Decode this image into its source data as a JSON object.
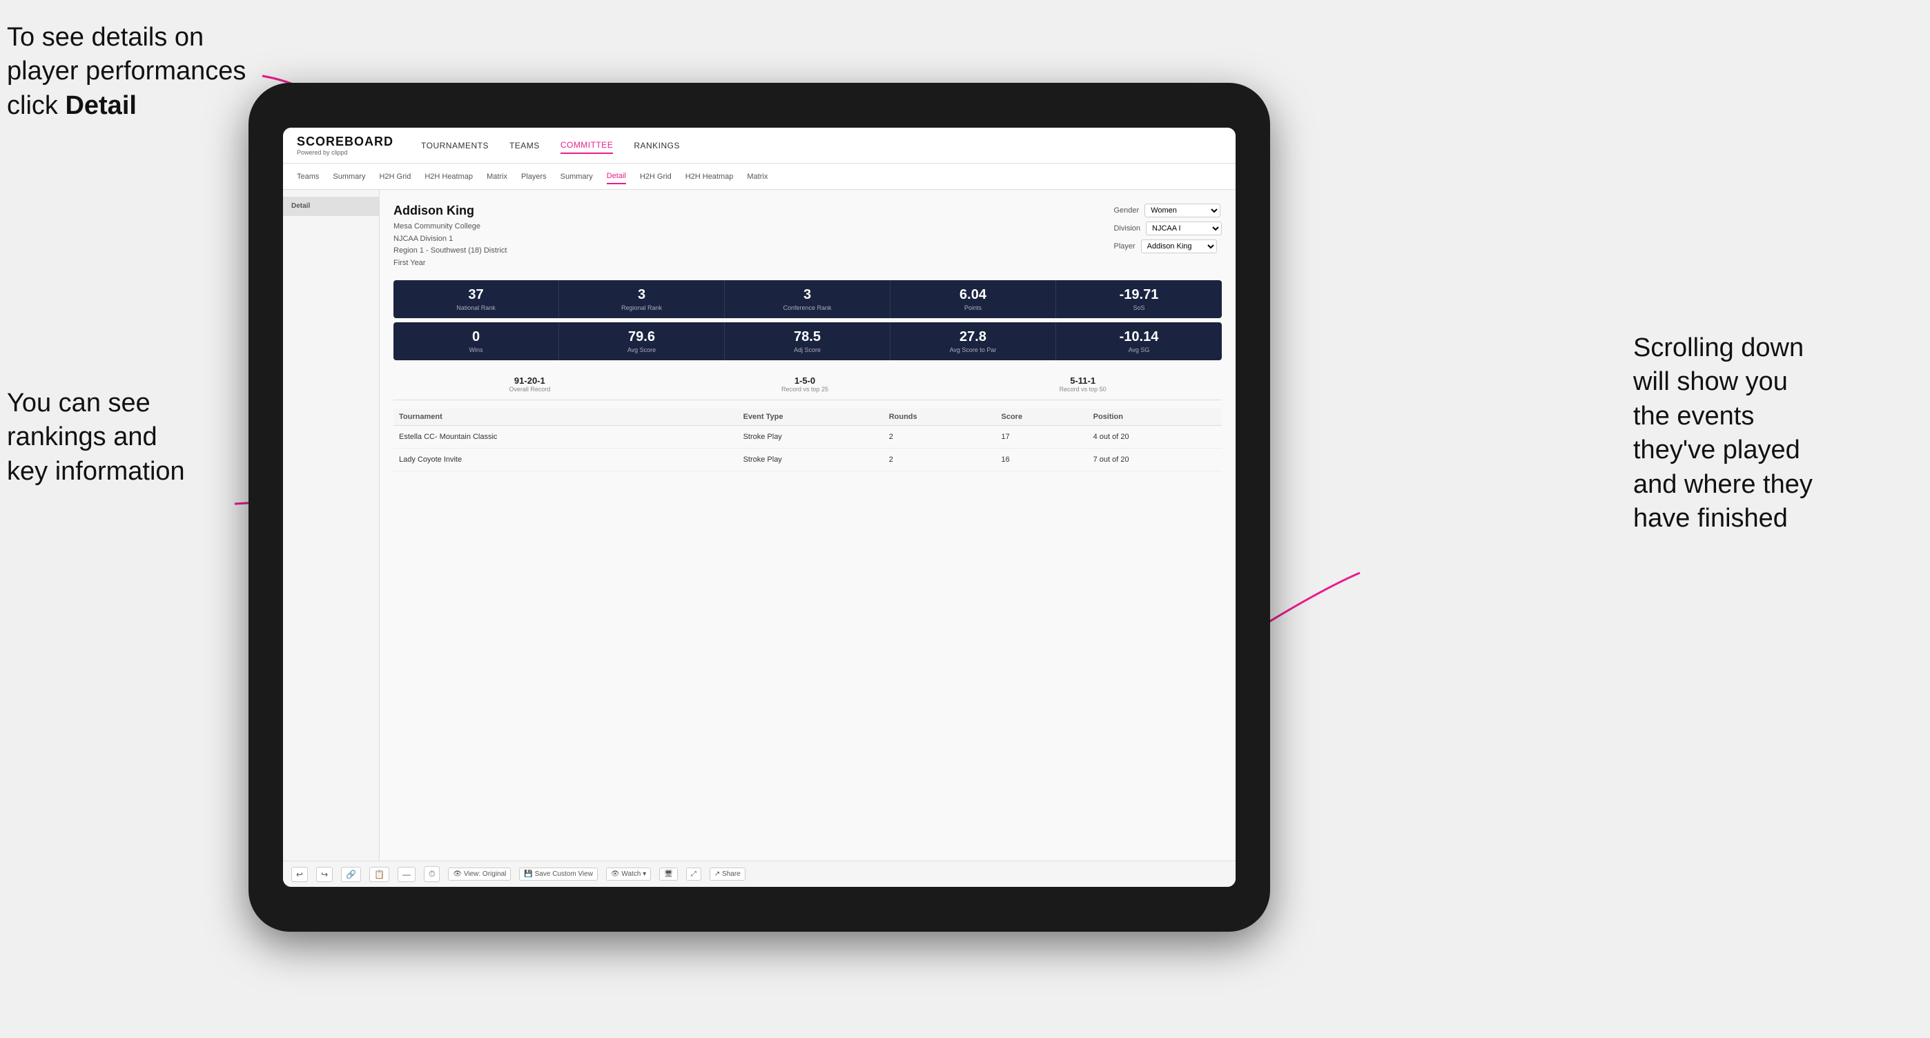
{
  "annotations": {
    "top_left": "To see details on player performances click ",
    "top_left_bold": "Detail",
    "bottom_left_line1": "You can see",
    "bottom_left_line2": "rankings and",
    "bottom_left_line3": "key information",
    "right_line1": "Scrolling down",
    "right_line2": "will show you",
    "right_line3": "the events",
    "right_line4": "they've played",
    "right_line5": "and where they",
    "right_line6": "have finished"
  },
  "nav": {
    "logo": "SCOREBOARD",
    "logo_sub": "Powered by clippd",
    "items": [
      {
        "label": "TOURNAMENTS",
        "active": false
      },
      {
        "label": "TEAMS",
        "active": false
      },
      {
        "label": "COMMITTEE",
        "active": false
      },
      {
        "label": "RANKINGS",
        "active": false
      }
    ]
  },
  "sub_nav": {
    "items": [
      {
        "label": "Teams",
        "active": false
      },
      {
        "label": "Summary",
        "active": false
      },
      {
        "label": "H2H Grid",
        "active": false
      },
      {
        "label": "H2H Heatmap",
        "active": false
      },
      {
        "label": "Matrix",
        "active": false
      },
      {
        "label": "Players",
        "active": false
      },
      {
        "label": "Summary",
        "active": false
      },
      {
        "label": "Detail",
        "active": true
      },
      {
        "label": "H2H Grid",
        "active": false
      },
      {
        "label": "H2H Heatmap",
        "active": false
      },
      {
        "label": "Matrix",
        "active": false
      }
    ]
  },
  "player": {
    "name": "Addison King",
    "school": "Mesa Community College",
    "division": "NJCAA Division 1",
    "region": "Region 1 - Southwest (18) District",
    "year": "First Year"
  },
  "filters": {
    "gender_label": "Gender",
    "gender_value": "Women",
    "division_label": "Division",
    "division_value": "NJCAA I",
    "player_label": "Player",
    "player_value": "Addison King"
  },
  "stats_row1": [
    {
      "value": "37",
      "label": "National Rank"
    },
    {
      "value": "3",
      "label": "Regional Rank"
    },
    {
      "value": "3",
      "label": "Conference Rank"
    },
    {
      "value": "6.04",
      "label": "Points"
    },
    {
      "value": "-19.71",
      "label": "SoS"
    }
  ],
  "stats_row2": [
    {
      "value": "0",
      "label": "Wins"
    },
    {
      "value": "79.6",
      "label": "Avg Score"
    },
    {
      "value": "78.5",
      "label": "Adj Score"
    },
    {
      "value": "27.8",
      "label": "Avg Score to Par"
    },
    {
      "value": "-10.14",
      "label": "Avg SG"
    }
  ],
  "records": [
    {
      "value": "91-20-1",
      "label": "Overall Record"
    },
    {
      "value": "1-5-0",
      "label": "Record vs top 25"
    },
    {
      "value": "5-11-1",
      "label": "Record vs top 50"
    }
  ],
  "table": {
    "headers": [
      "Tournament",
      "",
      "Event Type",
      "Rounds",
      "Score",
      "Position"
    ],
    "rows": [
      {
        "tournament": "Estella CC- Mountain Classic",
        "event_type": "Stroke Play",
        "rounds": "2",
        "score": "17",
        "position": "4 out of 20"
      },
      {
        "tournament": "Lady Coyote Invite",
        "event_type": "Stroke Play",
        "rounds": "2",
        "score": "16",
        "position": "7 out of 20"
      }
    ]
  },
  "toolbar": {
    "buttons": [
      {
        "label": "⟲",
        "text": ""
      },
      {
        "label": "⟳",
        "text": ""
      },
      {
        "label": "🔗",
        "text": ""
      },
      {
        "label": "📋",
        "text": ""
      },
      {
        "label": "—",
        "text": ""
      },
      {
        "label": "⏱",
        "text": ""
      },
      {
        "label": "👁",
        "text": "View: Original"
      },
      {
        "label": "💾",
        "text": "Save Custom View"
      },
      {
        "label": "👁",
        "text": "Watch ▾"
      },
      {
        "label": "🖥",
        "text": ""
      },
      {
        "label": "⤢",
        "text": ""
      },
      {
        "label": "↗",
        "text": "Share"
      }
    ]
  }
}
